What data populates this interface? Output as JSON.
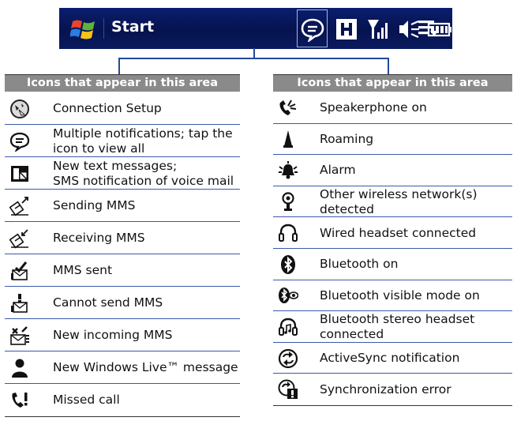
{
  "title_bar": {
    "start_label": "Start"
  },
  "left_table": {
    "header": "Icons that appear in this area",
    "rows": [
      {
        "icon": "connection-setup-icon",
        "label": "Connection Setup"
      },
      {
        "icon": "multiple-notifications-icon",
        "label": "Multiple notifications; tap the\nicon to view all"
      },
      {
        "icon": "new-text-messages-icon",
        "label": "New text messages;\nSMS notification of voice mail"
      },
      {
        "icon": "sending-mms-icon",
        "label": "Sending MMS"
      },
      {
        "icon": "receiving-mms-icon",
        "label": "Receiving MMS"
      },
      {
        "icon": "mms-sent-icon",
        "label": "MMS sent"
      },
      {
        "icon": "cannot-send-mms-icon",
        "label": "Cannot send MMS"
      },
      {
        "icon": "new-incoming-mms-icon",
        "label": "New incoming MMS"
      },
      {
        "icon": "windows-live-message-icon",
        "label": "New Windows Live™ message"
      },
      {
        "icon": "missed-call-icon",
        "label": "Missed call"
      }
    ]
  },
  "right_table": {
    "header": "Icons that appear in this area",
    "rows": [
      {
        "icon": "speakerphone-icon",
        "label": "Speakerphone on"
      },
      {
        "icon": "roaming-icon",
        "label": "Roaming"
      },
      {
        "icon": "alarm-icon",
        "label": "Alarm"
      },
      {
        "icon": "wireless-network-icon",
        "label": "Other wireless network(s)\ndetected"
      },
      {
        "icon": "wired-headset-icon",
        "label": "Wired headset connected"
      },
      {
        "icon": "bluetooth-icon",
        "label": "Bluetooth on"
      },
      {
        "icon": "bluetooth-visible-icon",
        "label": "Bluetooth visible mode on"
      },
      {
        "icon": "bluetooth-stereo-headset-icon",
        "label": "Bluetooth stereo headset\nconnected"
      },
      {
        "icon": "activesync-icon",
        "label": "ActiveSync notification"
      },
      {
        "icon": "sync-error-icon",
        "label": "Synchronization error"
      }
    ]
  }
}
